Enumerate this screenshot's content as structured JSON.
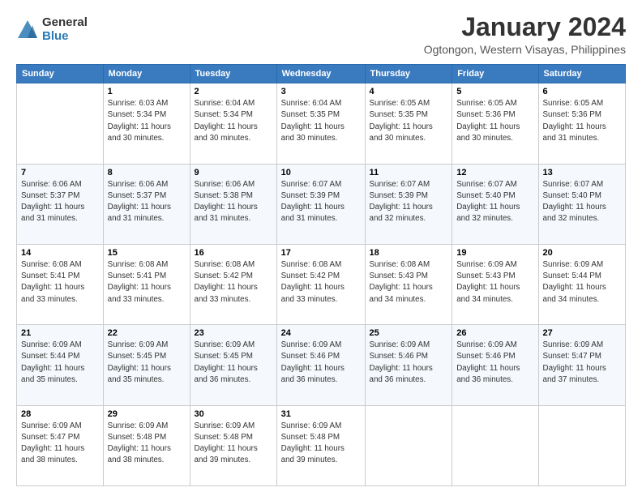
{
  "logo": {
    "general": "General",
    "blue": "Blue"
  },
  "header": {
    "month_title": "January 2024",
    "location": "Ogtongon, Western Visayas, Philippines"
  },
  "weekdays": [
    "Sunday",
    "Monday",
    "Tuesday",
    "Wednesday",
    "Thursday",
    "Friday",
    "Saturday"
  ],
  "weeks": [
    [
      {
        "day": "",
        "info": ""
      },
      {
        "day": "1",
        "info": "Sunrise: 6:03 AM\nSunset: 5:34 PM\nDaylight: 11 hours\nand 30 minutes."
      },
      {
        "day": "2",
        "info": "Sunrise: 6:04 AM\nSunset: 5:34 PM\nDaylight: 11 hours\nand 30 minutes."
      },
      {
        "day": "3",
        "info": "Sunrise: 6:04 AM\nSunset: 5:35 PM\nDaylight: 11 hours\nand 30 minutes."
      },
      {
        "day": "4",
        "info": "Sunrise: 6:05 AM\nSunset: 5:35 PM\nDaylight: 11 hours\nand 30 minutes."
      },
      {
        "day": "5",
        "info": "Sunrise: 6:05 AM\nSunset: 5:36 PM\nDaylight: 11 hours\nand 30 minutes."
      },
      {
        "day": "6",
        "info": "Sunrise: 6:05 AM\nSunset: 5:36 PM\nDaylight: 11 hours\nand 31 minutes."
      }
    ],
    [
      {
        "day": "7",
        "info": "Sunrise: 6:06 AM\nSunset: 5:37 PM\nDaylight: 11 hours\nand 31 minutes."
      },
      {
        "day": "8",
        "info": "Sunrise: 6:06 AM\nSunset: 5:37 PM\nDaylight: 11 hours\nand 31 minutes."
      },
      {
        "day": "9",
        "info": "Sunrise: 6:06 AM\nSunset: 5:38 PM\nDaylight: 11 hours\nand 31 minutes."
      },
      {
        "day": "10",
        "info": "Sunrise: 6:07 AM\nSunset: 5:39 PM\nDaylight: 11 hours\nand 31 minutes."
      },
      {
        "day": "11",
        "info": "Sunrise: 6:07 AM\nSunset: 5:39 PM\nDaylight: 11 hours\nand 32 minutes."
      },
      {
        "day": "12",
        "info": "Sunrise: 6:07 AM\nSunset: 5:40 PM\nDaylight: 11 hours\nand 32 minutes."
      },
      {
        "day": "13",
        "info": "Sunrise: 6:07 AM\nSunset: 5:40 PM\nDaylight: 11 hours\nand 32 minutes."
      }
    ],
    [
      {
        "day": "14",
        "info": "Sunrise: 6:08 AM\nSunset: 5:41 PM\nDaylight: 11 hours\nand 33 minutes."
      },
      {
        "day": "15",
        "info": "Sunrise: 6:08 AM\nSunset: 5:41 PM\nDaylight: 11 hours\nand 33 minutes."
      },
      {
        "day": "16",
        "info": "Sunrise: 6:08 AM\nSunset: 5:42 PM\nDaylight: 11 hours\nand 33 minutes."
      },
      {
        "day": "17",
        "info": "Sunrise: 6:08 AM\nSunset: 5:42 PM\nDaylight: 11 hours\nand 33 minutes."
      },
      {
        "day": "18",
        "info": "Sunrise: 6:08 AM\nSunset: 5:43 PM\nDaylight: 11 hours\nand 34 minutes."
      },
      {
        "day": "19",
        "info": "Sunrise: 6:09 AM\nSunset: 5:43 PM\nDaylight: 11 hours\nand 34 minutes."
      },
      {
        "day": "20",
        "info": "Sunrise: 6:09 AM\nSunset: 5:44 PM\nDaylight: 11 hours\nand 34 minutes."
      }
    ],
    [
      {
        "day": "21",
        "info": "Sunrise: 6:09 AM\nSunset: 5:44 PM\nDaylight: 11 hours\nand 35 minutes."
      },
      {
        "day": "22",
        "info": "Sunrise: 6:09 AM\nSunset: 5:45 PM\nDaylight: 11 hours\nand 35 minutes."
      },
      {
        "day": "23",
        "info": "Sunrise: 6:09 AM\nSunset: 5:45 PM\nDaylight: 11 hours\nand 36 minutes."
      },
      {
        "day": "24",
        "info": "Sunrise: 6:09 AM\nSunset: 5:46 PM\nDaylight: 11 hours\nand 36 minutes."
      },
      {
        "day": "25",
        "info": "Sunrise: 6:09 AM\nSunset: 5:46 PM\nDaylight: 11 hours\nand 36 minutes."
      },
      {
        "day": "26",
        "info": "Sunrise: 6:09 AM\nSunset: 5:46 PM\nDaylight: 11 hours\nand 36 minutes."
      },
      {
        "day": "27",
        "info": "Sunrise: 6:09 AM\nSunset: 5:47 PM\nDaylight: 11 hours\nand 37 minutes."
      }
    ],
    [
      {
        "day": "28",
        "info": "Sunrise: 6:09 AM\nSunset: 5:47 PM\nDaylight: 11 hours\nand 38 minutes."
      },
      {
        "day": "29",
        "info": "Sunrise: 6:09 AM\nSunset: 5:48 PM\nDaylight: 11 hours\nand 38 minutes."
      },
      {
        "day": "30",
        "info": "Sunrise: 6:09 AM\nSunset: 5:48 PM\nDaylight: 11 hours\nand 39 minutes."
      },
      {
        "day": "31",
        "info": "Sunrise: 6:09 AM\nSunset: 5:48 PM\nDaylight: 11 hours\nand 39 minutes."
      },
      {
        "day": "",
        "info": ""
      },
      {
        "day": "",
        "info": ""
      },
      {
        "day": "",
        "info": ""
      }
    ]
  ]
}
